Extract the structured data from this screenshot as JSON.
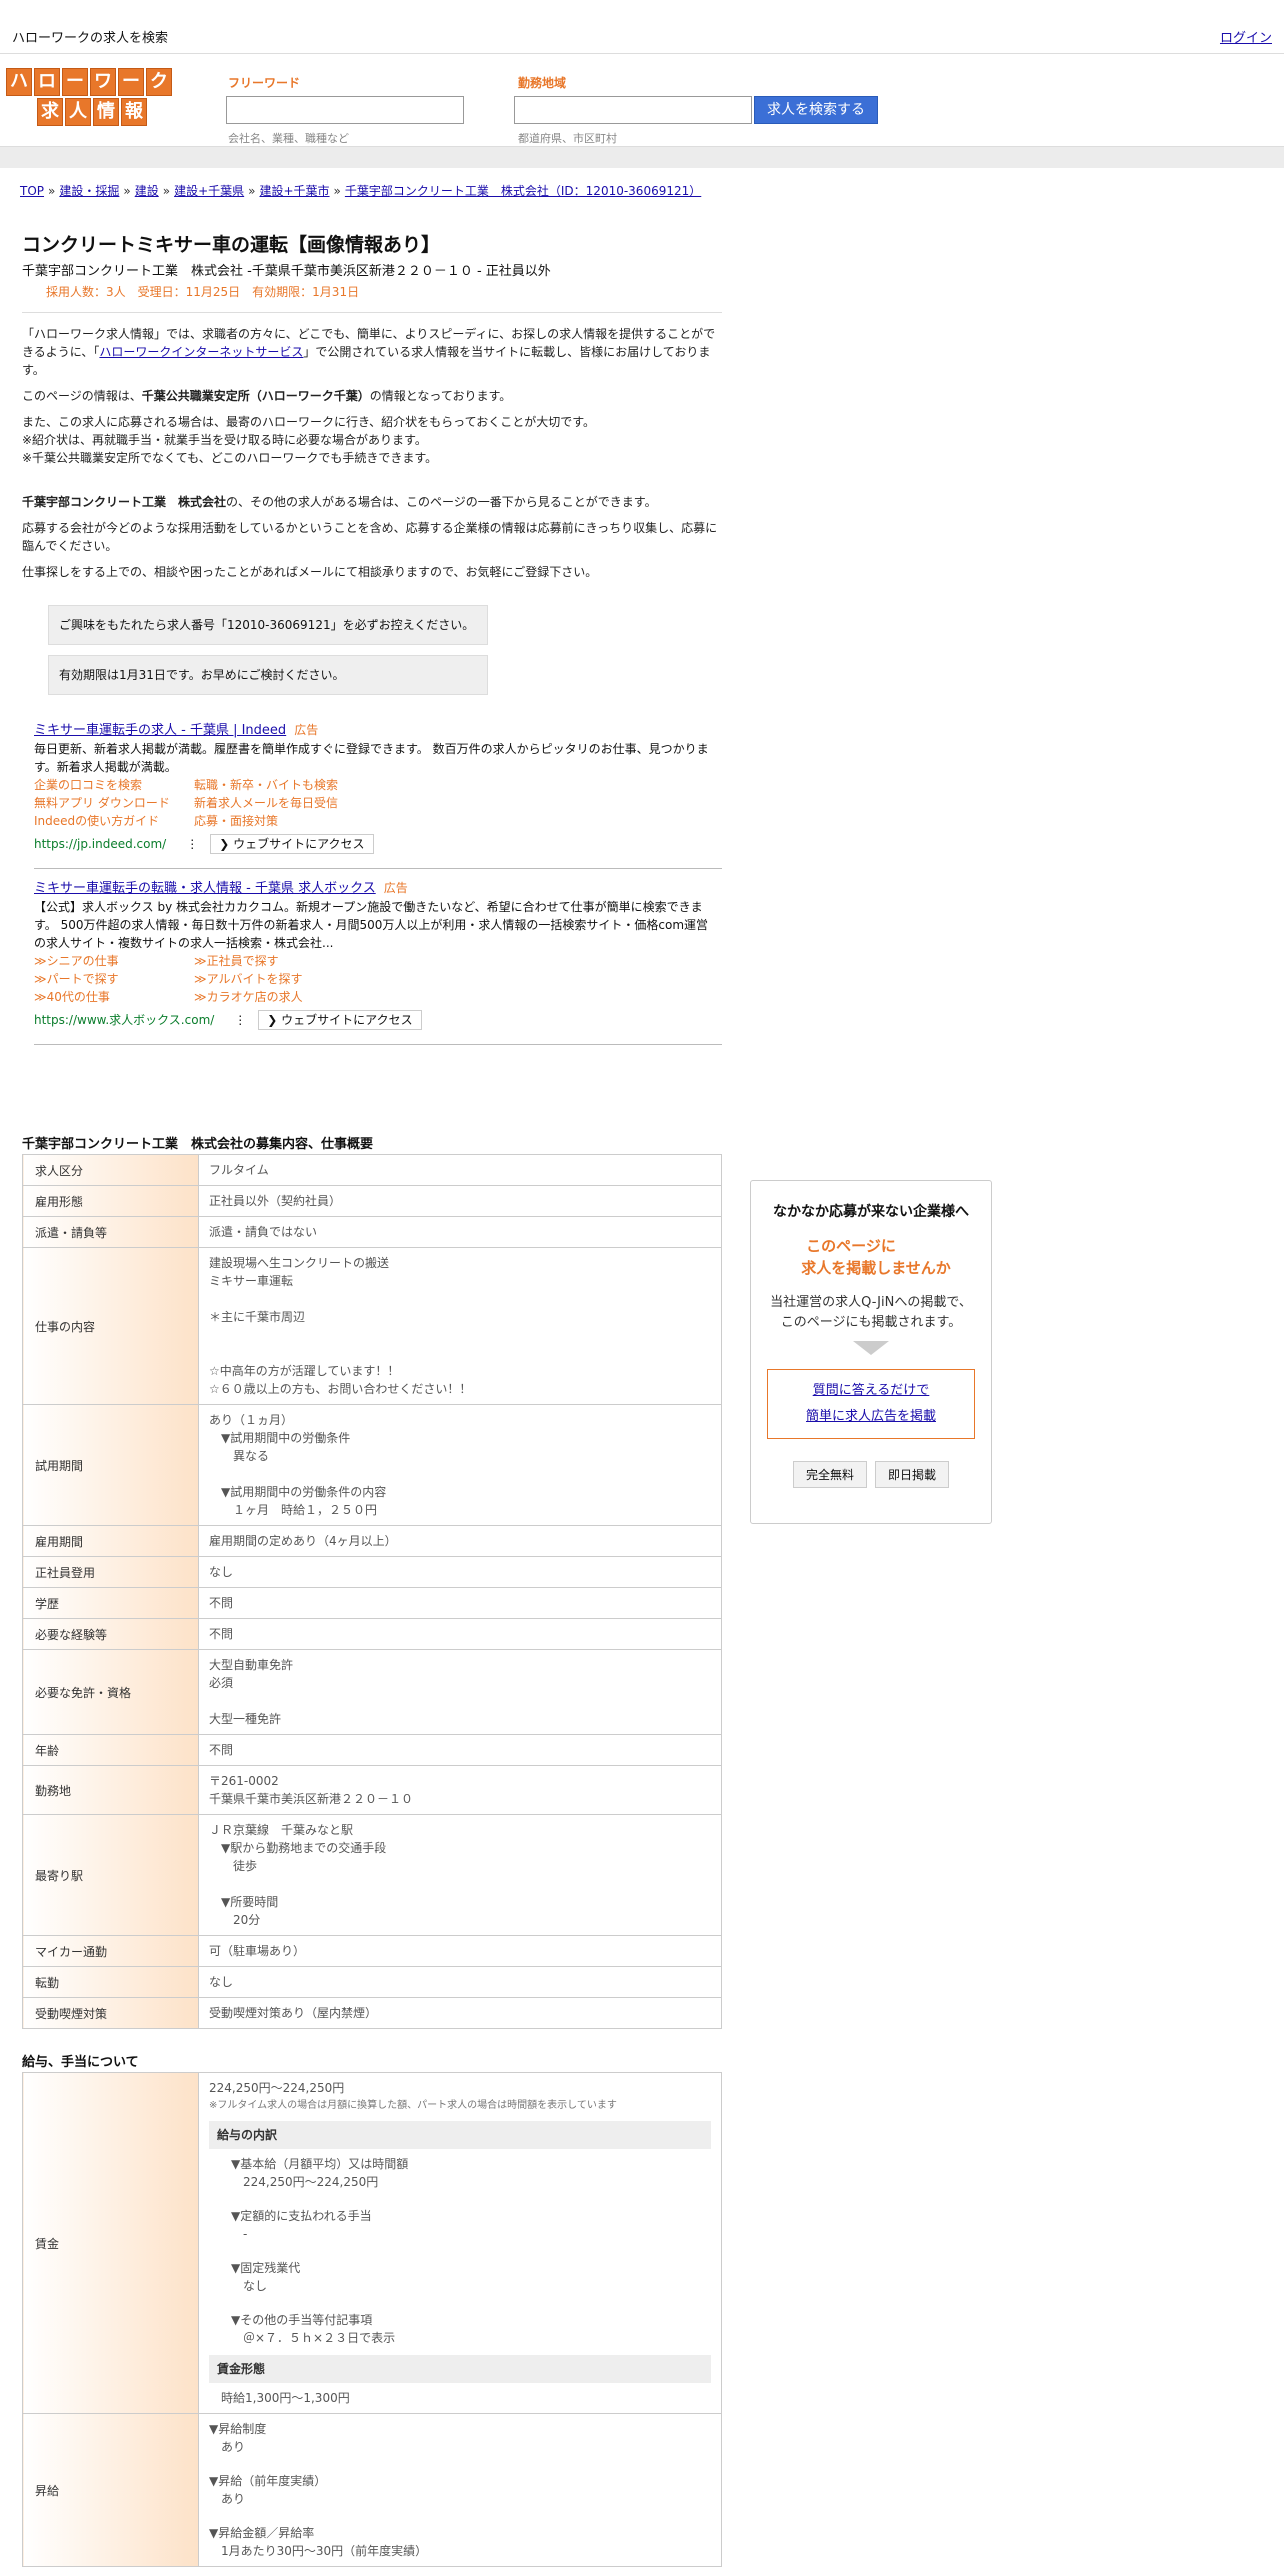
{
  "topbar": {
    "title": "ハローワークの求人を検索",
    "login": "ログイン"
  },
  "header": {
    "logo_top": [
      "ハ",
      "ロ",
      "ー",
      "ワ",
      "ー",
      "ク"
    ],
    "logo_bottom": [
      "求",
      "人",
      "情",
      "報"
    ],
    "free_label": "フリーワード",
    "area_label": "勤務地域",
    "free_hint": "会社名、業種、職種など",
    "area_hint": "都道府県、市区町村",
    "search_btn": "求人を検索する"
  },
  "breadcrumb": [
    "TOP",
    "建設・採掘",
    "建設",
    "建設+千葉県",
    "建設+千葉市",
    "千葉宇部コンクリート工業　株式会社（ID：12010-36069121）"
  ],
  "job": {
    "title": "コンクリートミキサー車の運転【画像情報あり】",
    "subtitle": "千葉宇部コンクリート工業　株式会社 -千葉県千葉市美浜区新港２２０－１０ - 正社員以外",
    "info": "採用人数：3人　受理日：11月25日　有効期限：1月31日"
  },
  "intro": {
    "p1a": "「ハローワーク求人情報」では、求職者の方々に、どこでも、簡単に、よりスピーディに、お探しの求人情報を提供することができるように、「",
    "p1link": "ハローワークインターネットサービス",
    "p1b": "」で公開されている求人情報を当サイトに転載し、皆様にお届けしております。",
    "p2a": "このページの情報は、",
    "p2b": "千葉公共職業安定所（ハローワーク千葉）",
    "p2c": "の情報となっております。",
    "p3": "また、この求人に応募される場合は、最寄のハローワークに行き、紹介状をもらっておくことが大切です。",
    "p4": "※紹介状は、再就職手当・就業手当を受け取る時に必要な場合があります。",
    "p5": "※千葉公共職業安定所でなくても、どこのハローワークでも手続きできます。",
    "p6a": "千葉宇部コンクリート工業　株式会社",
    "p6b": "の、その他の求人がある場合は、このページの一番下から見ることができます。",
    "p7": "応募する会社が今どのような採用活動をしているかということを含め、応募する企業様の情報は応募前にきっちり収集し、応募に臨んでください。",
    "p8": "仕事探しをする上での、相談や困ったことがあればメールにて相談承りますので、お気軽にご登録下さい。"
  },
  "notes": [
    "ご興味をもたれたら求人番号「12010-36069121」を必ずお控えください。",
    "有効期限は1月31日です。お早めにご検討ください。"
  ],
  "ads": [
    {
      "title": "ミキサー車運転手の求人 - 千葉県 | Indeed",
      "tag": "広告",
      "desc": "毎日更新、新着求人掲載が満載。履歴書を簡単作成すぐに登録できます。 数百万件の求人からピッタリのお仕事、見つかります。新着求人掲載が満載。",
      "links": [
        "企業の口コミを検索",
        "転職・新卒・バイトも検索",
        "無料アプリ ダウンロード",
        "新着求人メールを毎日受信",
        "Indeedの使い方ガイド",
        "応募・面接対策"
      ],
      "url": "https://jp.indeed.com/",
      "btn": "❯ ウェブサイトにアクセス"
    },
    {
      "title": "ミキサー車運転手の転職・求人情報 - 千葉県 求人ボックス",
      "tag": "広告",
      "desc": "【公式】求人ボックス by 株式会社カカクコム。新規オープン施設で働きたいなど、希望に合わせて仕事が簡単に検索できます。 500万件超の求人情報・毎日数十万件の新着求人・月間500万人以上が利用・求人情報の一括検索サイト・価格com運営の求人サイト・複数サイトの求人一括検索・株式会社...",
      "links": [
        "≫シニアの仕事",
        "≫正社員で探す",
        "≫パートで探す",
        "≫アルバイトを探す",
        "≫40代の仕事",
        "≫カラオケ店の求人"
      ],
      "url": "https://www.求人ボックス.com/",
      "btn": "❯ ウェブサイトにアクセス"
    }
  ],
  "table1": {
    "heading": "千葉宇部コンクリート工業　株式会社の募集内容、仕事概要",
    "rows": [
      {
        "k": "求人区分",
        "v": [
          "フルタイム"
        ]
      },
      {
        "k": "雇用形態",
        "v": [
          "正社員以外（契約社員）"
        ]
      },
      {
        "k": "派遣・請負等",
        "v": [
          "派遣・請負ではない"
        ]
      },
      {
        "k": "仕事の内容",
        "v": [
          "建設現場へ生コンクリートの搬送",
          "ミキサー車運転",
          "",
          "＊主に千葉市周辺",
          "",
          "",
          "☆中高年の方が活躍しています！！",
          "☆６０歳以上の方も、お問い合わせください！！"
        ]
      },
      {
        "k": "試用期間",
        "v": [
          "あり（１ヵ月）",
          "　▼試用期間中の労働条件",
          "　　異なる",
          "",
          "　▼試用期間中の労働条件の内容",
          "　　１ヶ月　時給１，２５０円"
        ]
      },
      {
        "k": "雇用期間",
        "v": [
          "雇用期間の定めあり（4ヶ月以上）"
        ]
      },
      {
        "k": "正社員登用",
        "v": [
          "なし"
        ]
      },
      {
        "k": "学歴",
        "v": [
          "不問"
        ]
      },
      {
        "k": "必要な経験等",
        "v": [
          "不問"
        ]
      },
      {
        "k": "必要な免許・資格",
        "v": [
          "大型自動車免許",
          "必須",
          "",
          "大型一種免許"
        ]
      },
      {
        "k": "年齢",
        "v": [
          "不問"
        ]
      },
      {
        "k": "勤務地",
        "v": [
          "〒261-0002",
          "千葉県千葉市美浜区新港２２０－１０"
        ]
      },
      {
        "k": "最寄り駅",
        "v": [
          "ＪＲ京葉線　千葉みなと駅",
          "　▼駅から勤務地までの交通手段",
          "　　徒歩",
          "",
          "　▼所要時間",
          "　　20分"
        ]
      },
      {
        "k": "マイカー通勤",
        "v": [
          "可（駐車場あり）"
        ]
      },
      {
        "k": "転勤",
        "v": [
          "なし"
        ]
      },
      {
        "k": "受動喫煙対策",
        "v": [
          "受動喫煙対策あり（屋内禁煙）"
        ]
      }
    ]
  },
  "table2": {
    "heading": "給与、手当について",
    "wage_key": "賃金",
    "wage_range": "224,250円〜224,250円",
    "wage_note": "※フルタイム求人の場合は月額に換算した額、パート求人の場合は時間額を表示しています",
    "breakdown_hd": "給与の内訳",
    "breakdown": [
      "▼基本給（月額平均）又は時間額",
      "　224,250円〜224,250円",
      "",
      "▼定額的に支払われる手当",
      "　-",
      "",
      "▼固定残業代",
      "　なし",
      "",
      "▼その他の手当等付記事項",
      "　＠×７．５ｈ×２３日で表示"
    ],
    "form_hd": "賃金形態",
    "form": "時給1,300円〜1,300円",
    "raise_key": "昇給",
    "raise": [
      "▼昇給制度",
      "　あり",
      "",
      "▼昇給（前年度実績）",
      "　あり",
      "",
      "▼昇給金額／昇給率",
      "　1月あたり30円〜30円（前年度実績）"
    ]
  },
  "side": {
    "heading": "なかなか応募が来ない企業様へ",
    "offer1": "このページに",
    "offer2": "求人を掲載しませんか",
    "desc1": "当社運営の求人Q-JiNへの掲載で、",
    "desc2": "このページにも掲載されます。",
    "link1": "質問に答えるだけで",
    "link2": "簡単に求人広告を掲載",
    "btn1": "完全無料",
    "btn2": "即日掲載"
  }
}
